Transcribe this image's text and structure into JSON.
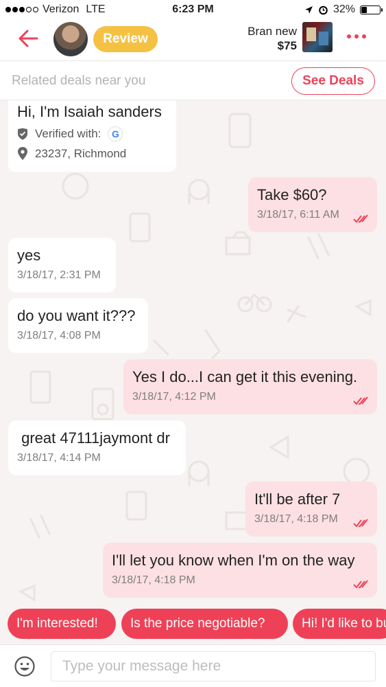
{
  "status_bar": {
    "carrier": "Verizon",
    "network": "LTE",
    "time": "6:23 PM",
    "battery": "32%",
    "battery_level": 0.32
  },
  "header": {
    "back_icon": "arrow-left-icon",
    "review_label": "Review",
    "item_title": "Bran new",
    "item_price": "$75",
    "more_icon": "more-dots-icon"
  },
  "related": {
    "text": "Related deals near you",
    "button": "See Deals"
  },
  "profile": {
    "name": "Hi, I'm Isaiah sanders",
    "verified_label": "Verified with:",
    "google_letter": "G",
    "location": "23237, Richmond"
  },
  "messages": [
    {
      "dir": "out",
      "text": "Take $60?",
      "time": "3/18/17, 6:11 AM"
    },
    {
      "dir": "in",
      "text": "yes",
      "time": "3/18/17, 2:31 PM"
    },
    {
      "dir": "in",
      "text": "do you want it???",
      "time": "3/18/17, 4:08 PM"
    },
    {
      "dir": "out",
      "text": "Yes I do...I can get it this evening.",
      "time": "3/18/17, 4:12 PM"
    },
    {
      "dir": "in",
      "text": " great 47111jaymont dr",
      "time": "3/18/17, 4:14 PM"
    },
    {
      "dir": "out",
      "text": "It'll be after 7",
      "time": "3/18/17, 4:18 PM"
    },
    {
      "dir": "out",
      "text": "I'll let you know when I'm on the way",
      "time": "3/18/17, 4:18 PM"
    }
  ],
  "quick_replies": [
    "I'm interested!",
    "Is the price negotiable?",
    "Hi! I'd like to buy"
  ],
  "input": {
    "placeholder": "Type your message here",
    "emoji_icon": "emoji-smiley-icon"
  },
  "colors": {
    "accent": "#ee4157",
    "review": "#f5c142",
    "outgoing_bubble": "#fde0e3",
    "incoming_bubble": "#ffffff",
    "background": "#f6f3f2"
  }
}
